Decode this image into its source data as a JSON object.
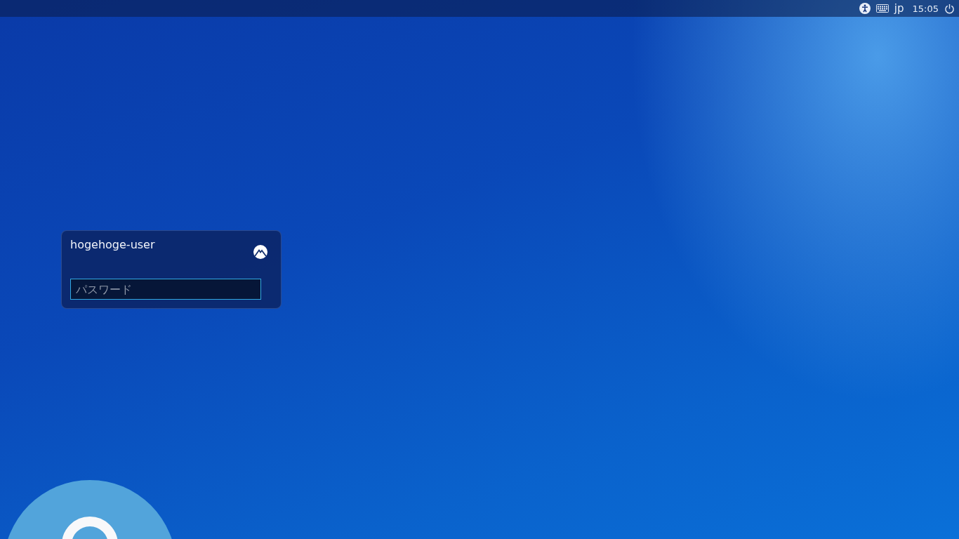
{
  "top_bar": {
    "keyboard_layout": "jp",
    "clock": "15:05"
  },
  "login": {
    "username": "hogehoge-user",
    "password": {
      "placeholder": "パスワード"
    }
  }
}
